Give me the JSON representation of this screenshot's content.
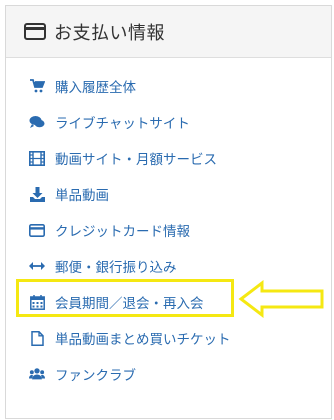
{
  "header": {
    "title": "お支払い情報",
    "icon": "credit-card-icon"
  },
  "menu": {
    "items": [
      {
        "label": "購入履歴全体",
        "icon": "cart-icon"
      },
      {
        "label": "ライブチャットサイト",
        "icon": "chat-icon"
      },
      {
        "label": "動画サイト・月額サービス",
        "icon": "film-icon"
      },
      {
        "label": "単品動画",
        "icon": "download-icon"
      },
      {
        "label": "クレジットカード情報",
        "icon": "credit-card-icon"
      },
      {
        "label": "郵便・銀行振り込み",
        "icon": "arrows-horizontal-icon"
      },
      {
        "label": "会員期間／退会・再入会",
        "icon": "calendar-icon"
      },
      {
        "label": "単品動画まとめ買いチケット",
        "icon": "file-icon"
      },
      {
        "label": "ファンクラブ",
        "icon": "users-icon"
      }
    ]
  },
  "annotation": {
    "highlight_color": "#f5e812",
    "highlighted_item": "会員期間／退会・再入会"
  },
  "colors": {
    "link": "#2a6bb0",
    "header_bg": "#f5f5f5",
    "border": "#d9d9d9"
  }
}
